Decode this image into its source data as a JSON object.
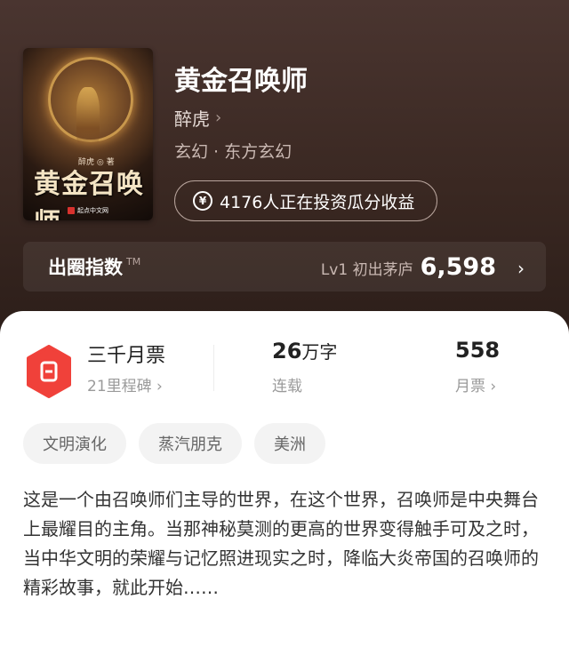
{
  "book": {
    "title": "黄金召唤师",
    "author": "醉虎",
    "genre": "玄幻 · 东方玄幻",
    "invest_text": "4176人正在投资瓜分收益"
  },
  "cover": {
    "author_small": "醉虎 ◎ 著",
    "title": "黄金召唤师",
    "publisher": "起点中文网"
  },
  "index_bar": {
    "label": "出圈指数",
    "tm": "TM",
    "level": "Lv1 初出茅庐",
    "value": "6,598"
  },
  "stats": {
    "badge": {
      "title": "三千月票",
      "sub": "21里程碑"
    },
    "words": {
      "value": "26",
      "unit": "万字",
      "sub": "连载"
    },
    "tickets": {
      "value": "558",
      "sub": "月票"
    }
  },
  "tags": [
    "文明演化",
    "蒸汽朋克",
    "美洲"
  ],
  "synopsis": "这是一个由召唤师们主导的世界，在这个世界，召唤师是中央舞台上最耀目的主角。当那神秘莫测的更高的世界变得触手可及之时，当中华文明的荣耀与记忆照进现实之时，降临大炎帝国的召唤师的精彩故事，就此开始……",
  "colors": {
    "hero_bg": "#3a2822",
    "badge_red": "#f0413a",
    "sheet_bg": "#ffffff"
  },
  "icons": {
    "author_chevron": "chevron-right-icon",
    "yen": "yen-coin-icon",
    "index_chevron": "chevron-right-icon",
    "badge": "monthly-ticket-badge-icon"
  }
}
